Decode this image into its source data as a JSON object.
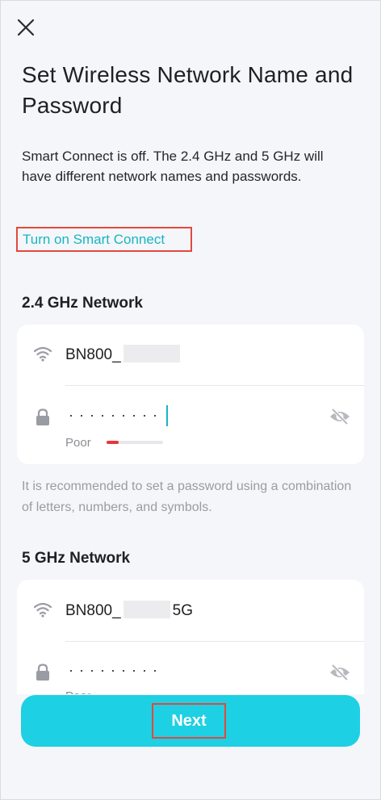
{
  "header": {
    "close_icon": "close-icon",
    "title": "Set Wireless Network Name and Password"
  },
  "description": "Smart Connect is off. The 2.4 GHz and 5 GHz will have different network names and passwords.",
  "smart_connect_link": "Turn on Smart Connect",
  "networks": [
    {
      "section_title": "2.4 GHz Network",
      "ssid_prefix": "BN800_",
      "ssid_suffix": "",
      "password_mask": "·········",
      "strength_label": "Poor",
      "strength_level": 0.22,
      "icons": [
        "wifi-icon",
        "lock-icon",
        "eye-off-icon"
      ]
    },
    {
      "section_title": "5 GHz Network",
      "ssid_prefix": "BN800_",
      "ssid_suffix": "5G",
      "password_mask": "·········",
      "strength_label": "Poor",
      "icons": [
        "wifi-icon",
        "lock-icon",
        "eye-off-icon"
      ]
    }
  ],
  "hint": "It is recommended to set a password using a combination of letters, numbers, and symbols.",
  "next_button": "Next",
  "colors": {
    "accent": "#16b6c2",
    "button": "#1ed0e3",
    "highlight_box": "#e2483e",
    "weak_strength": "#e8353a"
  }
}
